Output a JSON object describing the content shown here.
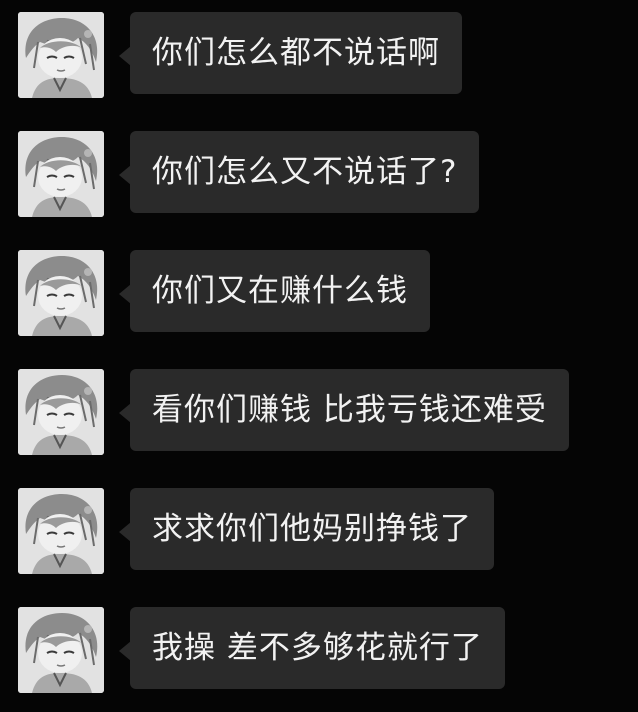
{
  "messages": [
    {
      "text": "你们怎么都不说话啊"
    },
    {
      "text": "你们怎么又不说话了?"
    },
    {
      "text": "你们又在赚什么钱"
    },
    {
      "text": "看你们赚钱 比我亏钱还难受"
    },
    {
      "text": "求求你们他妈别挣钱了"
    },
    {
      "text": "我操 差不多够花就行了"
    }
  ],
  "colors": {
    "background": "#050505",
    "bubble": "#2a2a2a",
    "text": "#f2f2f2"
  }
}
